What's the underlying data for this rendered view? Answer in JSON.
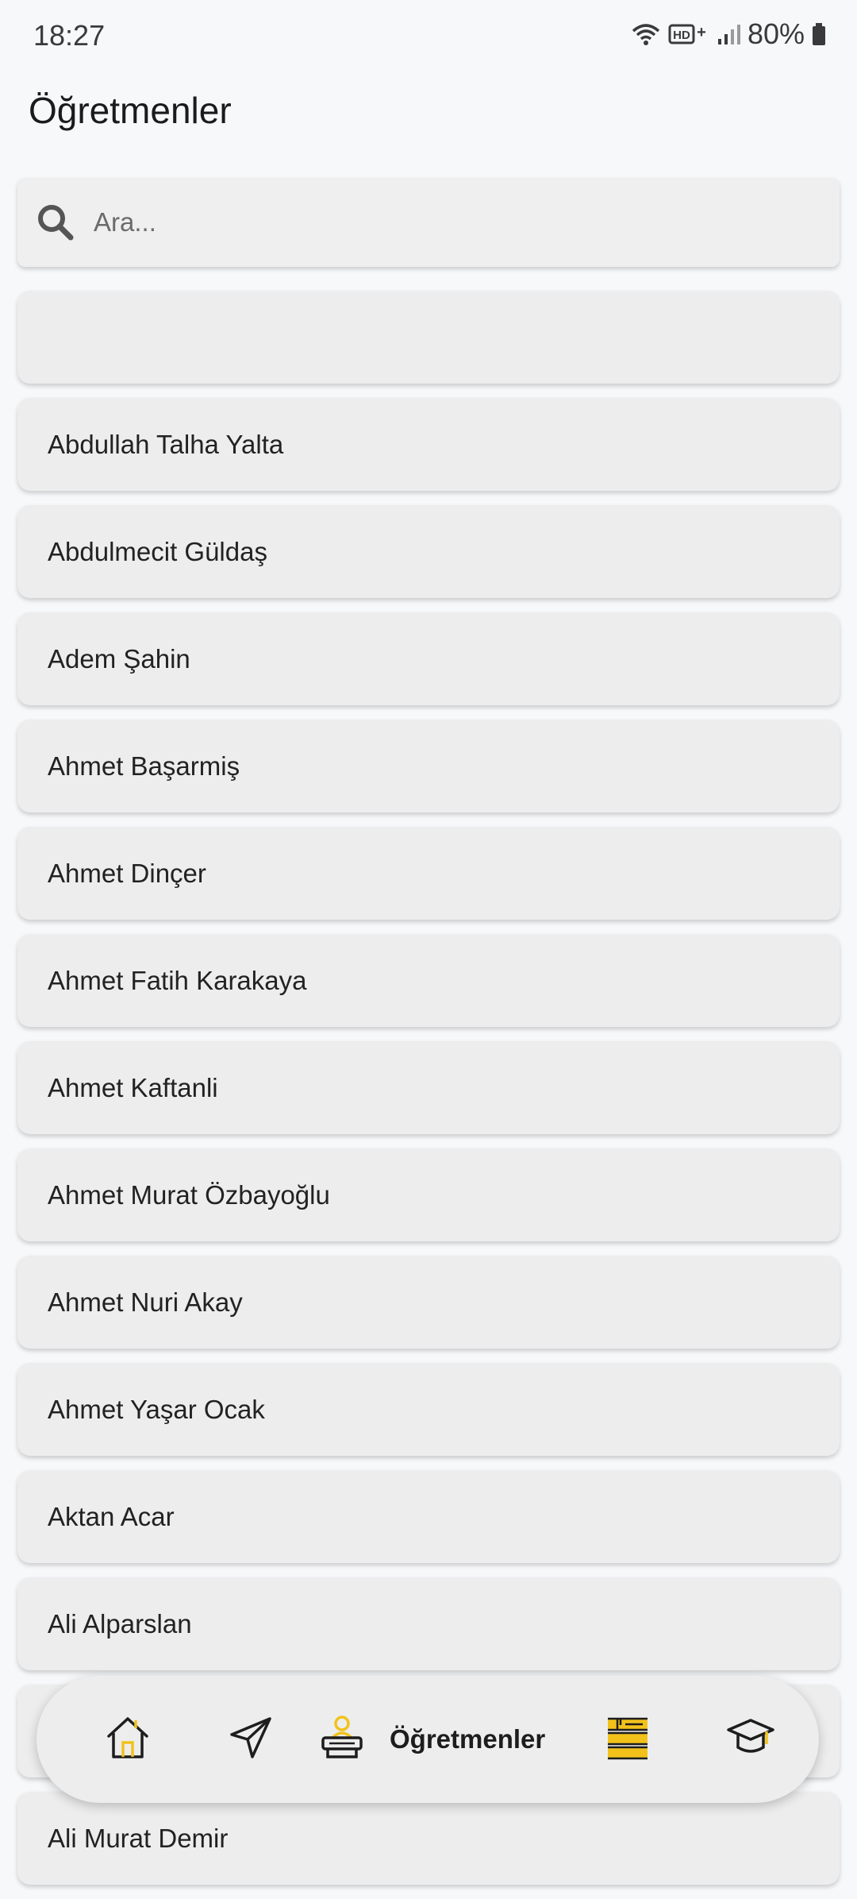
{
  "status_bar": {
    "time": "18:27",
    "network": "HD+",
    "battery": "80%"
  },
  "page": {
    "title": "Öğretmenler"
  },
  "search": {
    "placeholder": "Ara...",
    "value": ""
  },
  "teachers": [
    "",
    "Abdullah Talha Yalta",
    "Abdulmecit Güldaş",
    "Adem Şahin",
    "Ahmet Başarmiş",
    "Ahmet Dinçer",
    "Ahmet Fatih Karakaya",
    "Ahmet Kaftanli",
    "Ahmet Murat Özbayoğlu",
    "Ahmet Nuri Akay",
    "Ahmet Yaşar Ocak",
    "Aktan Acar",
    "Ali Alparslan",
    "",
    "Ali Murat Demir"
  ],
  "bottom_nav": {
    "items": [
      {
        "icon": "home-icon",
        "label": ""
      },
      {
        "icon": "send-icon",
        "label": ""
      },
      {
        "icon": "teacher-icon",
        "label": "Öğretmenler",
        "active": true
      },
      {
        "icon": "books-icon",
        "label": ""
      },
      {
        "icon": "graduation-cap-icon",
        "label": ""
      }
    ]
  },
  "colors": {
    "background": "#f7f8fa",
    "card": "#ededed",
    "accent": "#f2c21b",
    "text": "#222222"
  }
}
